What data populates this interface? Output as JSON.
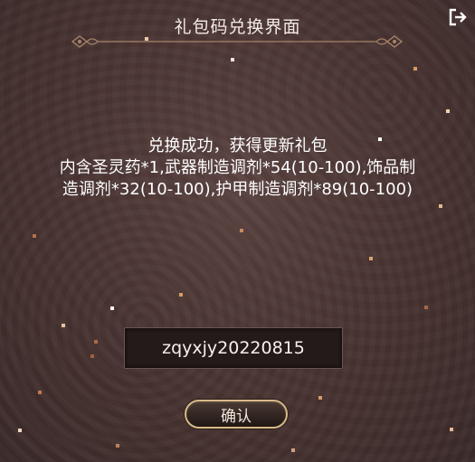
{
  "dialog": {
    "title": "礼包码兑换界面",
    "exit_icon": "exit-icon"
  },
  "message": {
    "line1": "兑换成功，获得更新礼包",
    "line2": "内含圣灵药*1,武器制造调剂*54(10-100),饰品制",
    "line3": "造调剂*32(10-100),护甲制造调剂*89(10-100)"
  },
  "code_input": {
    "value": "zqyxjy20220815"
  },
  "confirm_button": {
    "label": "确认"
  },
  "colors": {
    "background": "#4a3533",
    "accent_gold": "#d9b986",
    "text": "#ffffff"
  }
}
